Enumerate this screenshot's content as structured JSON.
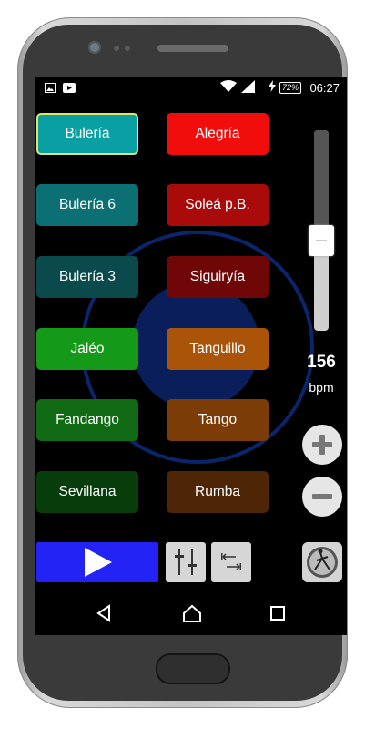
{
  "status_bar": {
    "time": "06:27",
    "battery": "72%",
    "icons": [
      "image-icon",
      "video-icon",
      "wifi-icon",
      "signal-icon",
      "charging-icon"
    ]
  },
  "palos_left": [
    {
      "label": "Bulería",
      "color": "#0a9fa3",
      "selected": true
    },
    {
      "label": "Bulería 6",
      "color": "#0b6f73"
    },
    {
      "label": "Bulería 3",
      "color": "#0a4a4d"
    },
    {
      "label": "Jaléo",
      "color": "#149a18"
    },
    {
      "label": "Fandango",
      "color": "#0f6a13"
    },
    {
      "label": "Sevillana",
      "color": "#073d0a"
    }
  ],
  "palos_right": [
    {
      "label": "Alegría",
      "color": "#f20d0d"
    },
    {
      "label": "Soleá p.B.",
      "color": "#a90a0a"
    },
    {
      "label": "Siguiryía",
      "color": "#700707"
    },
    {
      "label": "Tanguillo",
      "color": "#a95409"
    },
    {
      "label": "Tango",
      "color": "#7b3c07"
    },
    {
      "label": "Rumba",
      "color": "#4e2606"
    }
  ],
  "tempo": {
    "value": "156",
    "unit": "bpm",
    "slider_level": 0.45
  },
  "controls": {
    "plus_icon": "plus-icon",
    "minus_icon": "minus-icon",
    "play_icon": "play-icon",
    "mixer_icon": "mixer-icon",
    "shift_icon": "shift-icon",
    "logo_icon": "dancer-logo-icon"
  },
  "colors": {
    "play_button": "#2323f5",
    "selected_border": "#d8e86a"
  },
  "nav": {
    "back": "back-icon",
    "home": "home-icon",
    "recents": "recents-icon"
  }
}
